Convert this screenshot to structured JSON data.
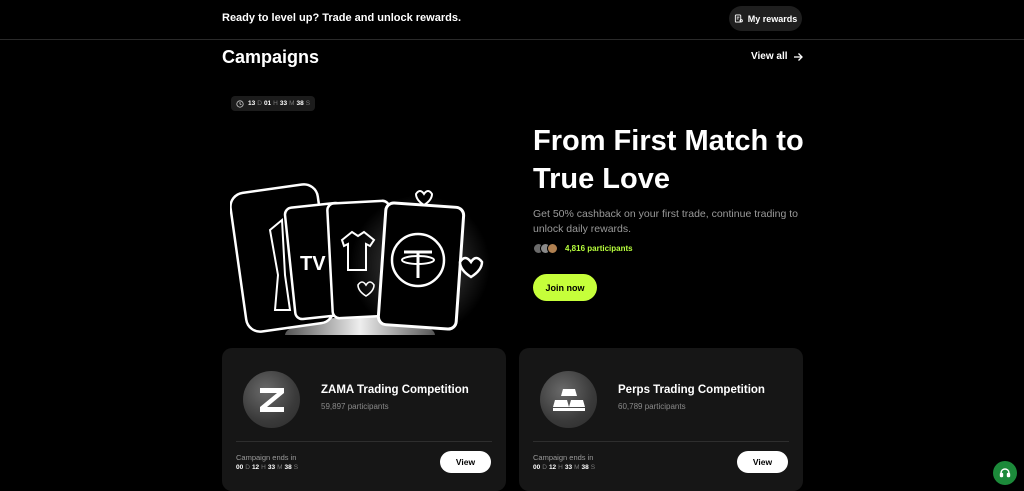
{
  "topbar": {
    "message": "Ready to level up? Trade and unlock rewards.",
    "rewards_label": "My rewards"
  },
  "campaigns": {
    "title": "Campaigns",
    "view_all": "View all"
  },
  "hero": {
    "timer": {
      "d": "13",
      "d_unit": "D",
      "h": "01",
      "h_unit": "H",
      "m": "33",
      "m_unit": "M",
      "s": "38",
      "s_unit": "S"
    },
    "title": "From First Match to True Love",
    "description": "Get 50% cashback on your first trade, continue trading to unlock daily rewards.",
    "participants": "4,816 participants",
    "join_label": "Join now"
  },
  "cards": [
    {
      "name": "ZAMA Trading Competition",
      "participants": "59,897 participants",
      "ends_label": "Campaign ends in",
      "ends": {
        "d": "00",
        "d_unit": "D",
        "h": "12",
        "h_unit": "H",
        "m": "33",
        "m_unit": "M",
        "s": "38",
        "s_unit": "S"
      },
      "view_label": "View",
      "icon": "zama-logo-icon"
    },
    {
      "name": "Perps Trading Competition",
      "participants": "60,789 participants",
      "ends_label": "Campaign ends in",
      "ends": {
        "d": "00",
        "d_unit": "D",
        "h": "12",
        "h_unit": "H",
        "m": "33",
        "m_unit": "M",
        "s": "38",
        "s_unit": "S"
      },
      "view_label": "View",
      "icon": "gold-bars-icon"
    }
  ],
  "colors": {
    "accent": "#c6ff3a",
    "participants_text": "#b8ff3d",
    "support": "#1c8a3a",
    "card_bg": "#161616"
  }
}
